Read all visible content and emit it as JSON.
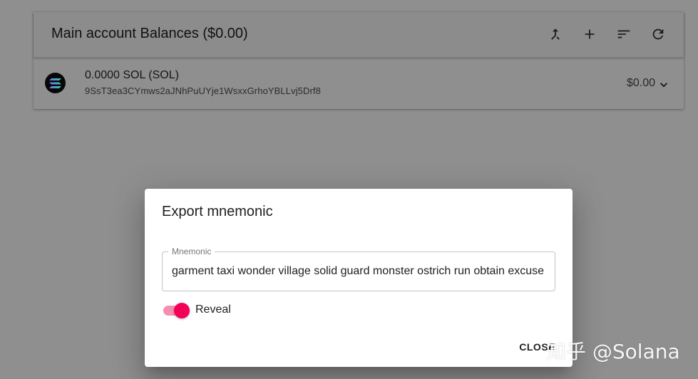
{
  "account": {
    "title": "Main account Balances ($0.00)",
    "icons": [
      "merge-icon",
      "add-icon",
      "sort-icon",
      "refresh-icon"
    ]
  },
  "balance_row": {
    "token_icon": "solana-logo-icon",
    "primary": "0.0000 SOL (SOL)",
    "address": "9SsT3ea3CYmws2aJNhPuUYje1WsxxGrhoYBLLvj5Drf8",
    "value": "$0.00",
    "expand_icon": "chevron-down-icon"
  },
  "dialog": {
    "title": "Export mnemonic",
    "mnemonic_label": "Mnemonic",
    "mnemonic_value": "garment taxi wonder village solid guard monster ostrich run obtain excuse",
    "reveal_label": "Reveal",
    "reveal_on": true,
    "close_label": "CLOSE"
  },
  "watermark": "知乎 @Solana",
  "colors": {
    "accent": "#f50057",
    "accent_track": "#f48fb1",
    "backdrop": "#8f8f8f",
    "dialog_bg": "#ffffff"
  }
}
